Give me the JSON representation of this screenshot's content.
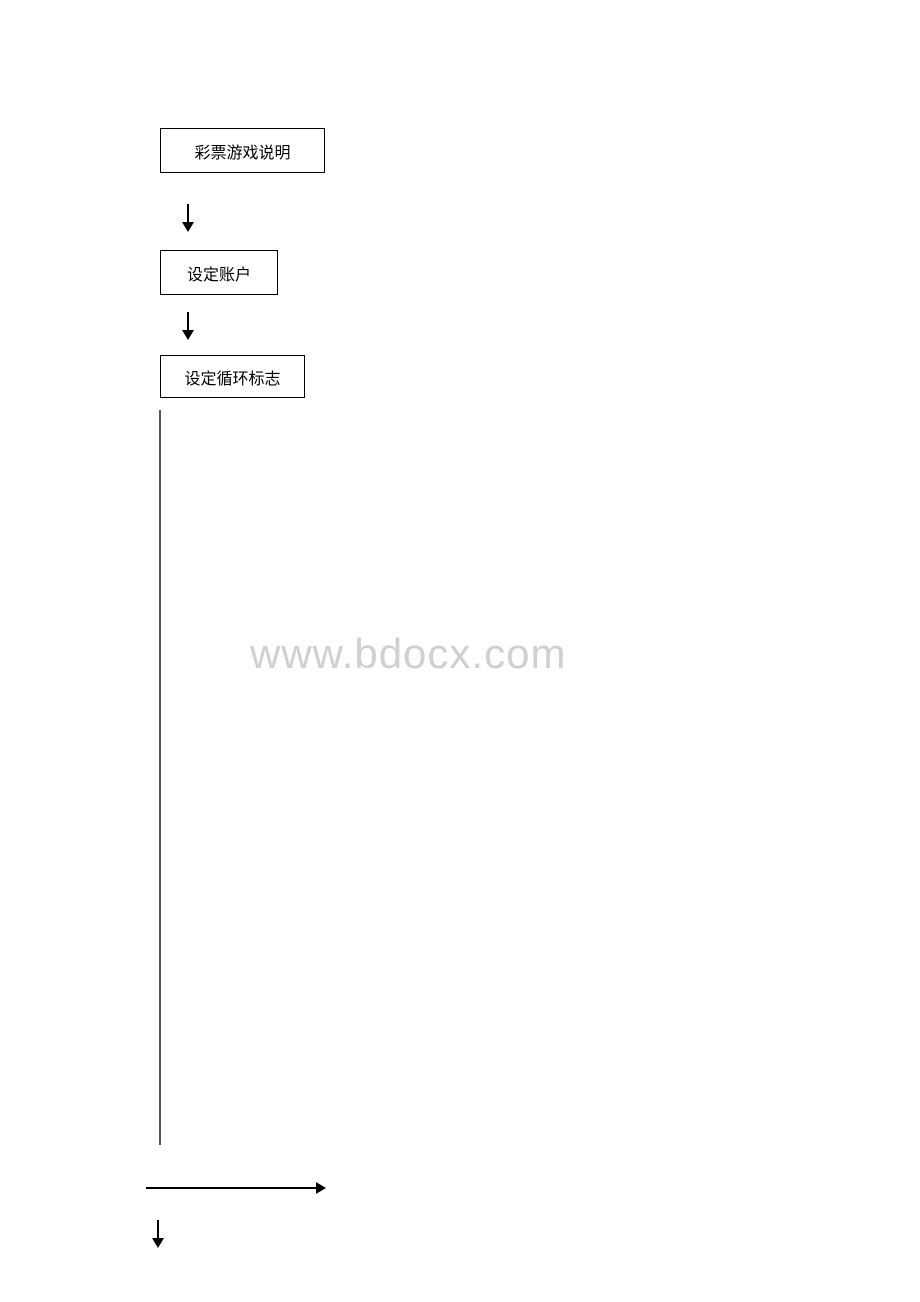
{
  "flowchart": {
    "box1": "彩票游戏说明",
    "box2": "设定账户",
    "box3": "设定循环标志"
  },
  "watermark": "www.bdocx.com"
}
